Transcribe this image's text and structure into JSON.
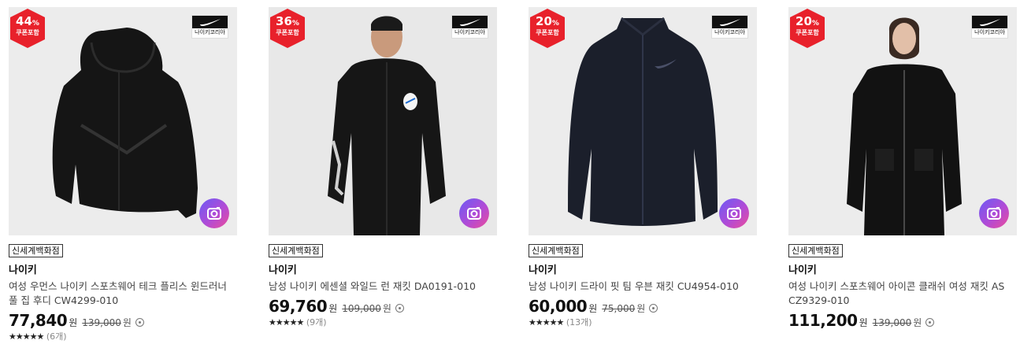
{
  "products": [
    {
      "discount_number": "44",
      "discount_unit": "%",
      "coupon_label": "쿠폰포함",
      "brand_logo_label": "나이키코리아",
      "store": "신세계백화점",
      "brand": "나이키",
      "name": "여성 우먼스 나이키 스포츠웨어 테크 플리스 윈드러너 풀 집 후디 CW4299-010",
      "sale_price": "77,840",
      "sale_unit": "원",
      "original_price": "139,000",
      "original_unit": "원",
      "stars": "★★★★★",
      "review_count": "(6개)"
    },
    {
      "discount_number": "36",
      "discount_unit": "%",
      "coupon_label": "쿠폰포함",
      "brand_logo_label": "나이키코리아",
      "store": "신세계백화점",
      "brand": "나이키",
      "name": "남성 나이키 에센셜 와일드 런 재킷 DA0191-010",
      "sale_price": "69,760",
      "sale_unit": "원",
      "original_price": "109,000",
      "original_unit": "원",
      "stars": "★★★★★",
      "review_count": "(9개)"
    },
    {
      "discount_number": "20",
      "discount_unit": "%",
      "coupon_label": "쿠폰포함",
      "brand_logo_label": "나이키코리아",
      "store": "신세계백화점",
      "brand": "나이키",
      "name": "남성 나이키 드라이 핏 팀 우븐 재킷 CU4954-010",
      "sale_price": "60,000",
      "sale_unit": "원",
      "original_price": "75,000",
      "original_unit": "원",
      "stars": "★★★★★",
      "review_count": "(13개)"
    },
    {
      "discount_number": "20",
      "discount_unit": "%",
      "coupon_label": "쿠폰포함",
      "brand_logo_label": "나이키코리아",
      "store": "신세계백화점",
      "brand": "나이키",
      "name": "여성 나이키 스포츠웨어 아이콘 클래쉬 여성 재킷 AS CZ9329-010",
      "sale_price": "111,200",
      "sale_unit": "원",
      "original_price": "139,000",
      "original_unit": "원"
    }
  ],
  "colors": {
    "badge_red": "#e8212b",
    "camera_gradient_start": "#6a5bf5",
    "camera_gradient_end": "#ec4c9a"
  },
  "icons": {
    "camera_search": "camera-search-icon",
    "brand_logo": "nike-swoosh-icon",
    "info": "info-circle-icon"
  }
}
